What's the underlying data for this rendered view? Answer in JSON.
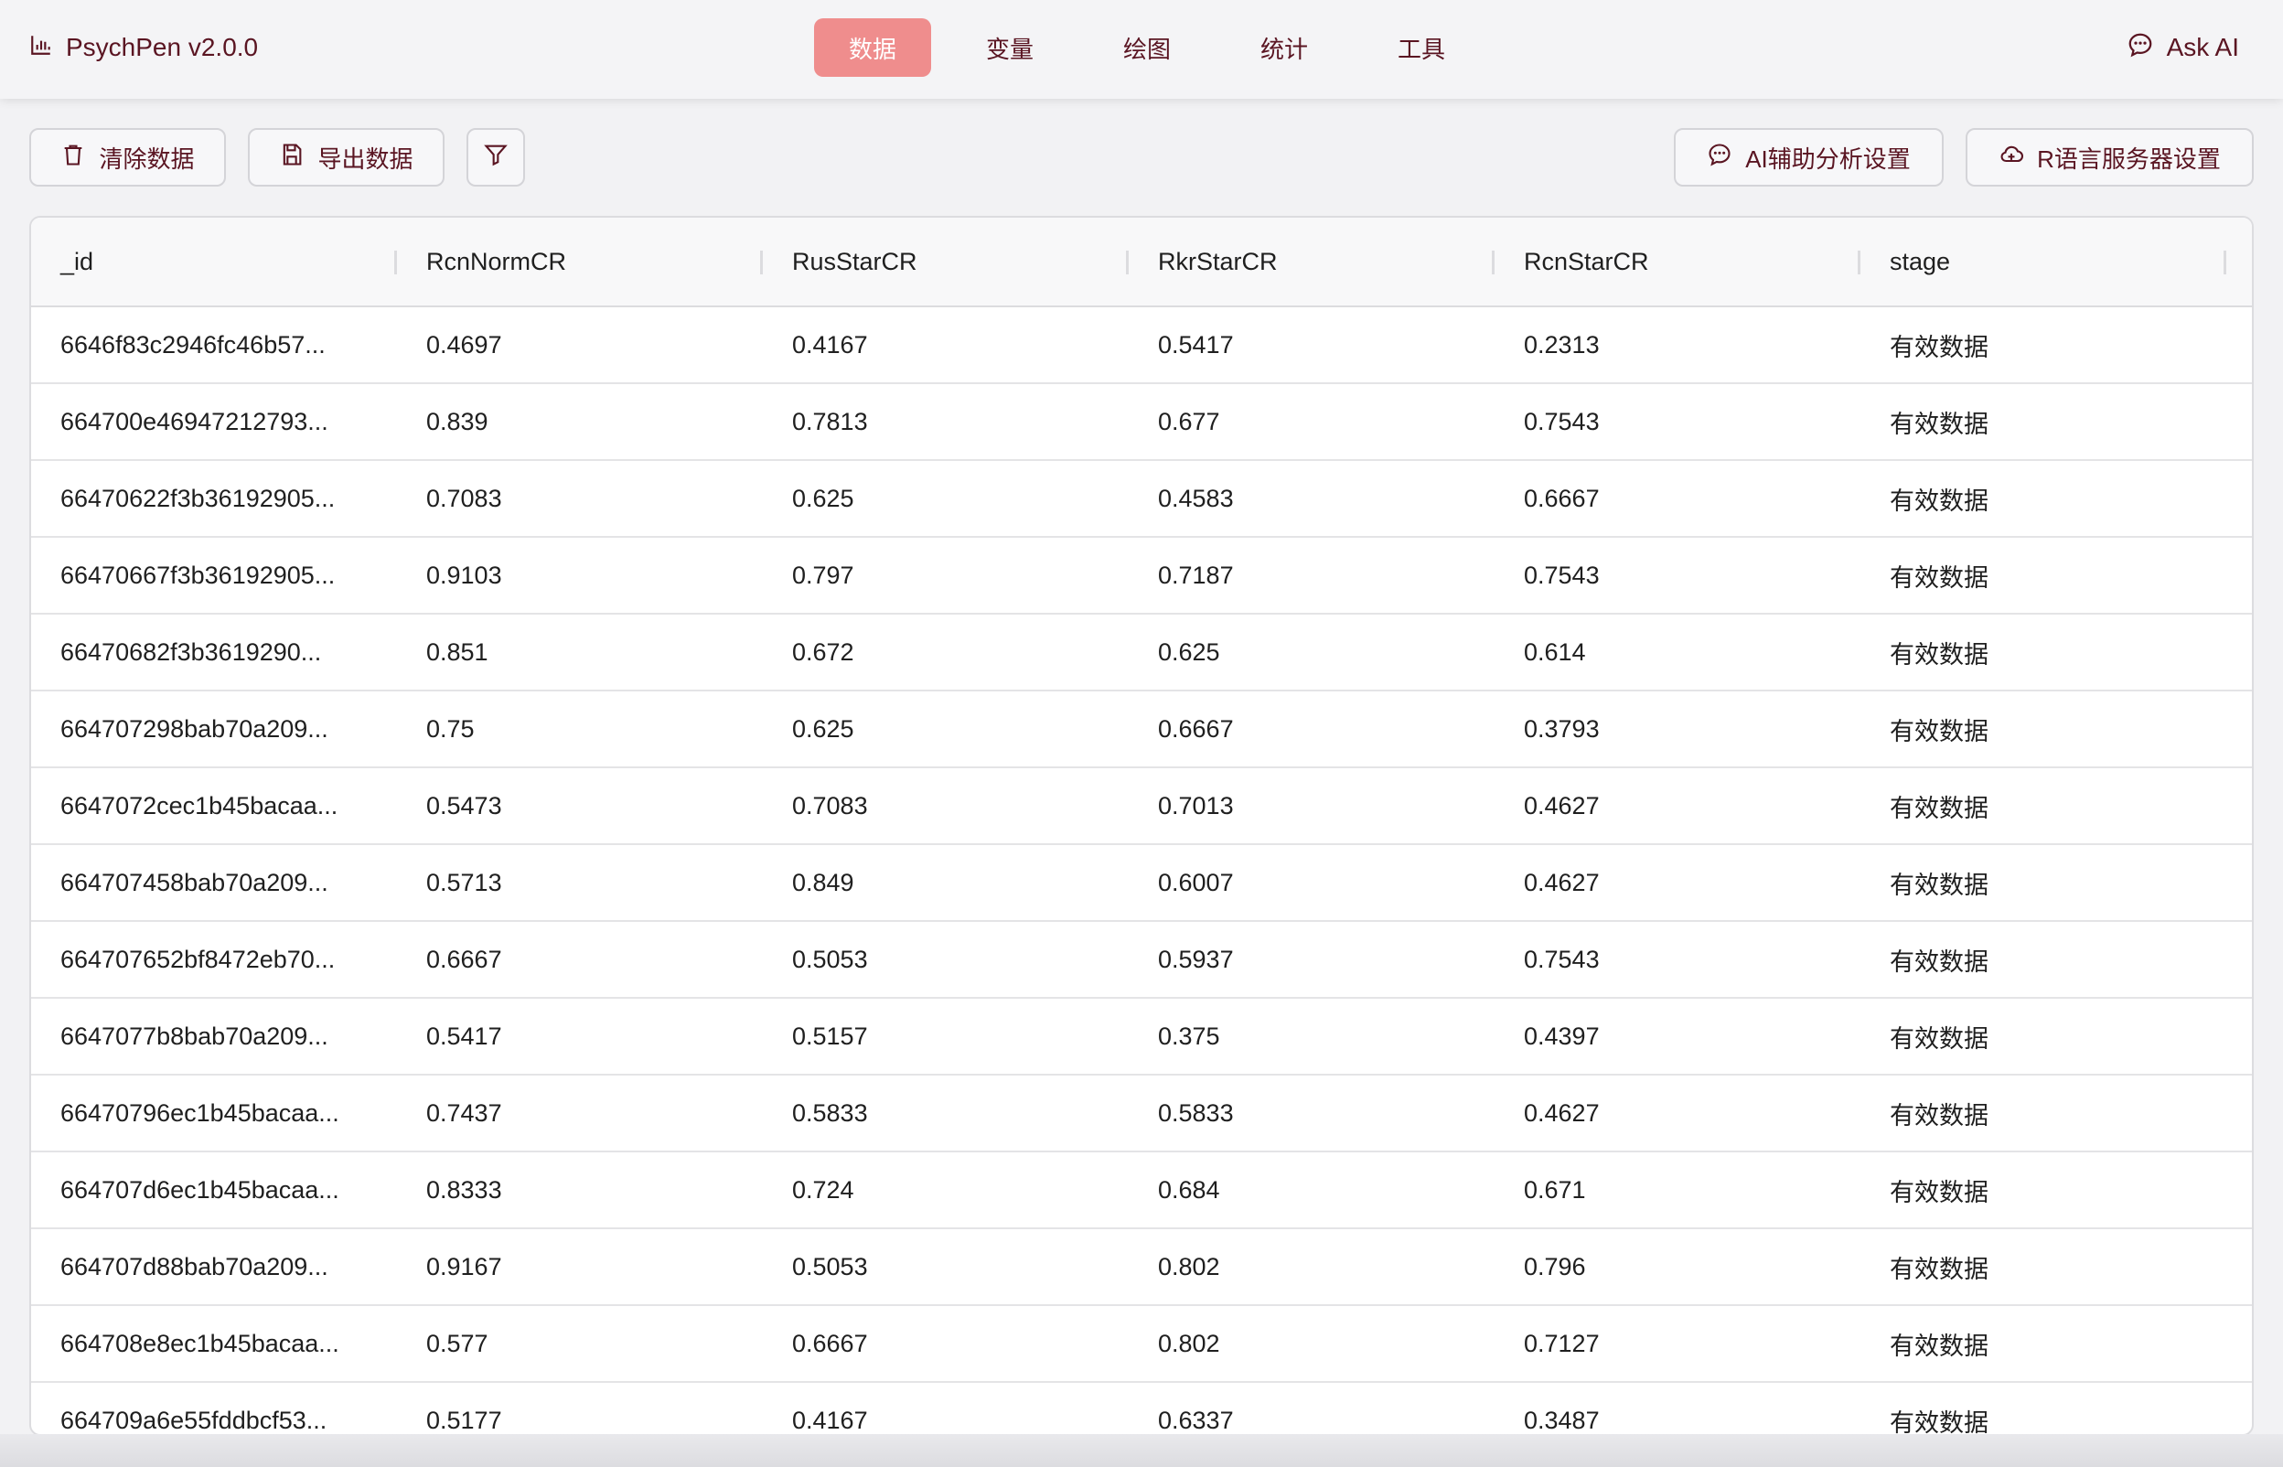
{
  "app": {
    "title": "PsychPen v2.0.0"
  },
  "nav": {
    "tabs": [
      {
        "label": "数据",
        "active": true
      },
      {
        "label": "变量"
      },
      {
        "label": "绘图"
      },
      {
        "label": "统计"
      },
      {
        "label": "工具"
      }
    ],
    "ask_ai_label": "Ask AI"
  },
  "toolbar": {
    "clear_label": "清除数据",
    "export_label": "导出数据",
    "ai_settings_label": "AI辅助分析设置",
    "r_server_label": "R语言服务器设置"
  },
  "table": {
    "columns": [
      "_id",
      "RcnNormCR",
      "RusStarCR",
      "RkrStarCR",
      "RcnStarCR",
      "stage"
    ],
    "rows": [
      [
        "6646f83c2946fc46b57...",
        "0.4697",
        "0.4167",
        "0.5417",
        "0.2313",
        "有效数据"
      ],
      [
        "664700e46947212793...",
        "0.839",
        "0.7813",
        "0.677",
        "0.7543",
        "有效数据"
      ],
      [
        "66470622f3b36192905...",
        "0.7083",
        "0.625",
        "0.4583",
        "0.6667",
        "有效数据"
      ],
      [
        "66470667f3b36192905...",
        "0.9103",
        "0.797",
        "0.7187",
        "0.7543",
        "有效数据"
      ],
      [
        "66470682f3b3619290...",
        "0.851",
        "0.672",
        "0.625",
        "0.614",
        "有效数据"
      ],
      [
        "664707298bab70a209...",
        "0.75",
        "0.625",
        "0.6667",
        "0.3793",
        "有效数据"
      ],
      [
        "6647072cec1b45bacaa...",
        "0.5473",
        "0.7083",
        "0.7013",
        "0.4627",
        "有效数据"
      ],
      [
        "664707458bab70a209...",
        "0.5713",
        "0.849",
        "0.6007",
        "0.4627",
        "有效数据"
      ],
      [
        "664707652bf8472eb70...",
        "0.6667",
        "0.5053",
        "0.5937",
        "0.7543",
        "有效数据"
      ],
      [
        "6647077b8bab70a209...",
        "0.5417",
        "0.5157",
        "0.375",
        "0.4397",
        "有效数据"
      ],
      [
        "66470796ec1b45bacaa...",
        "0.7437",
        "0.5833",
        "0.5833",
        "0.4627",
        "有效数据"
      ],
      [
        "664707d6ec1b45bacaa...",
        "0.8333",
        "0.724",
        "0.684",
        "0.671",
        "有效数据"
      ],
      [
        "664707d88bab70a209...",
        "0.9167",
        "0.5053",
        "0.802",
        "0.796",
        "有效数据"
      ],
      [
        "664708e8ec1b45bacaa...",
        "0.577",
        "0.6667",
        "0.802",
        "0.7127",
        "有效数据"
      ],
      [
        "664709a6e55fddbcf53...",
        "0.5177",
        "0.4167",
        "0.6337",
        "0.3487",
        "有效数据"
      ]
    ]
  },
  "colors": {
    "accent": "#ef8d8d",
    "brand_text": "#5a1522",
    "border": "#dcdcdf"
  },
  "icons": {
    "brand": "bar-chart-icon",
    "ask_ai": "chat-bubble-icon",
    "clear": "trash-icon",
    "export": "save-icon",
    "filter": "funnel-icon",
    "ai_settings": "chat-bubble-icon",
    "r_server": "cloud-icon"
  }
}
